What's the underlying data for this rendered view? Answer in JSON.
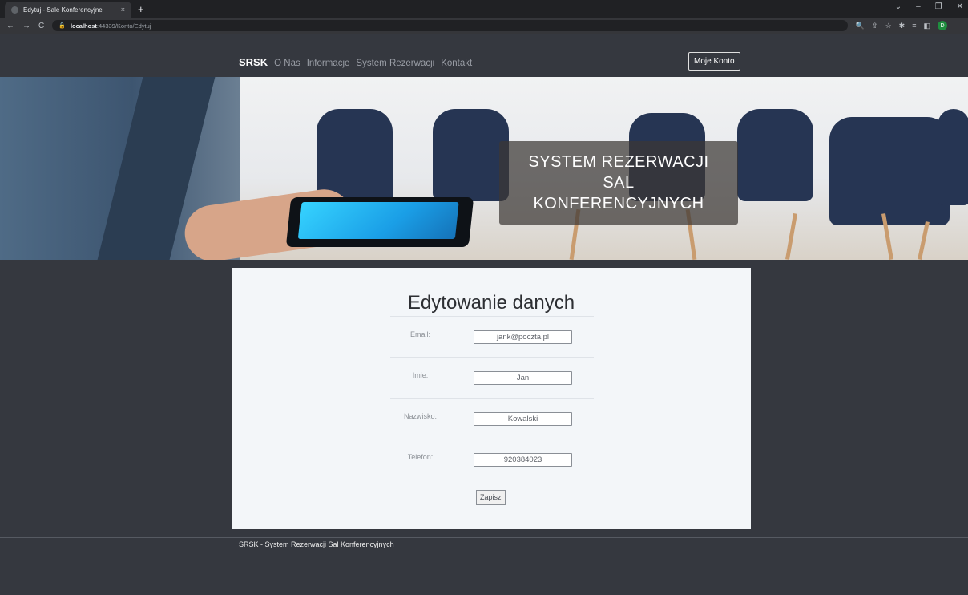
{
  "browser": {
    "tab_title": "Edytuj - Sale Konferencyjne",
    "tab_close": "×",
    "new_tab": "+",
    "url_host": "localhost",
    "url_rest": ":44339/Konto/Edytuj",
    "profile_initial": "D"
  },
  "nav": {
    "brand": "SRSK",
    "links": [
      "O Nas",
      "Informacje",
      "System Rezerwacji",
      "Kontakt"
    ],
    "account_button": "Moje Konto"
  },
  "hero": {
    "title_line1": "SYSTEM REZERWACJI",
    "title_line2": "SAL",
    "title_line3": "KONFERENCYJNYCH"
  },
  "form": {
    "heading": "Edytowanie danych",
    "fields": [
      {
        "label": "Email:",
        "value": "jank@poczta.pl"
      },
      {
        "label": "Imie:",
        "value": "Jan"
      },
      {
        "label": "Nazwisko:",
        "value": "Kowalski"
      },
      {
        "label": "Telefon:",
        "value": "920384023"
      }
    ],
    "submit_label": "Zapisz"
  },
  "footer": {
    "text": "SRSK - System Rezerwacji Sal Konferencyjnych"
  },
  "colors": {
    "page_bg": "#35383f",
    "card_bg": "#f3f6f9",
    "title_box": "#3c3734"
  }
}
